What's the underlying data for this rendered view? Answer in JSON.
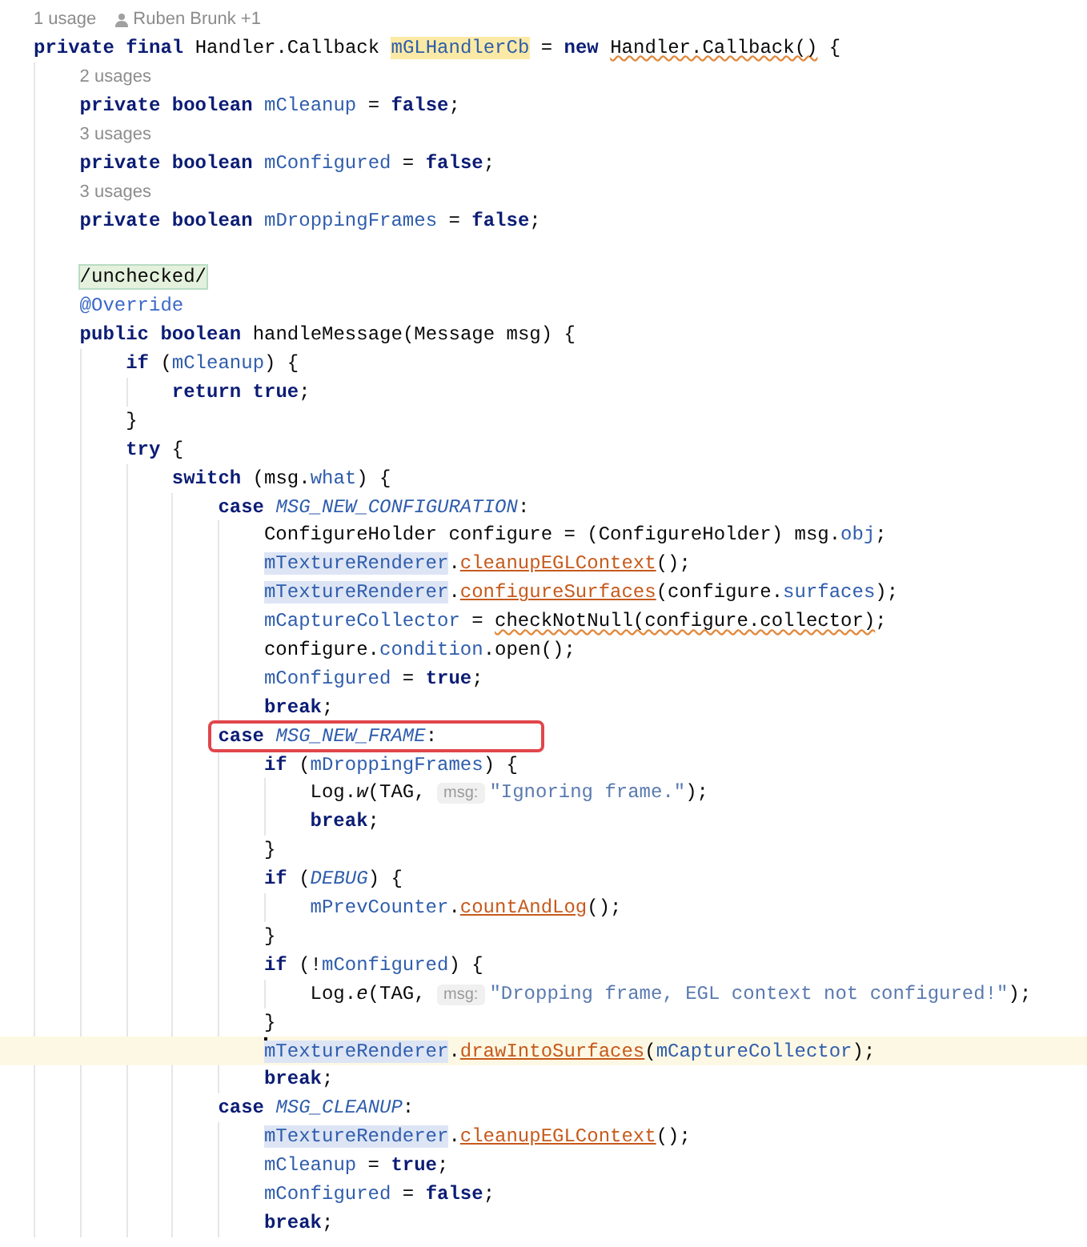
{
  "editor": {
    "lines": [
      {
        "kind": "usages",
        "text": "1 usage",
        "author": "Ruben Brunk +1"
      },
      {
        "kind": "code",
        "current": false,
        "tokens": [
          {
            "kind": "kw",
            "text": "private final"
          },
          {
            "kind": "plain",
            "text": " Handler.Callback "
          },
          {
            "kind": "field",
            "text": "mGLHandlerCb",
            "declaration_highlight": true
          },
          {
            "kind": "plain",
            "text": " = "
          },
          {
            "kind": "kw",
            "text": "new "
          },
          {
            "kind": "plain",
            "text": "Handler.Callback()",
            "warning": true
          },
          {
            "kind": "plain",
            "text": " {"
          }
        ],
        "children": [
          {
            "kind": "usages",
            "text": "2 usages"
          },
          {
            "kind": "code",
            "current": false,
            "tokens": [
              {
                "kind": "kw",
                "text": "private boolean "
              },
              {
                "kind": "field",
                "text": "mCleanup"
              },
              {
                "kind": "plain",
                "text": " = "
              },
              {
                "kind": "kw",
                "text": "false"
              },
              {
                "kind": "plain",
                "text": ";"
              }
            ]
          },
          {
            "kind": "usages",
            "text": "3 usages"
          },
          {
            "kind": "code",
            "current": false,
            "tokens": [
              {
                "kind": "kw",
                "text": "private boolean "
              },
              {
                "kind": "field",
                "text": "mConfigured"
              },
              {
                "kind": "plain",
                "text": " = "
              },
              {
                "kind": "kw",
                "text": "false"
              },
              {
                "kind": "plain",
                "text": ";"
              }
            ]
          },
          {
            "kind": "usages",
            "text": "3 usages"
          },
          {
            "kind": "code",
            "current": false,
            "tokens": [
              {
                "kind": "kw",
                "text": "private boolean "
              },
              {
                "kind": "field",
                "text": "mDroppingFrames"
              },
              {
                "kind": "plain",
                "text": " = "
              },
              {
                "kind": "kw",
                "text": "false"
              },
              {
                "kind": "plain",
                "text": ";"
              }
            ]
          },
          {
            "kind": "blank"
          },
          {
            "kind": "code",
            "current": false,
            "tokens": [
              {
                "kind": "plain",
                "text": "/unchecked/",
                "suppression_highlight": true
              }
            ]
          },
          {
            "kind": "code",
            "current": false,
            "tokens": [
              {
                "kind": "annotation",
                "text": "@Override"
              }
            ]
          },
          {
            "kind": "code",
            "current": false,
            "tokens": [
              {
                "kind": "kw",
                "text": "public boolean"
              },
              {
                "kind": "plain",
                "text": " handleMessage(Message msg) {"
              }
            ],
            "children": [
              {
                "kind": "code",
                "current": false,
                "tokens": [
                  {
                    "kind": "kw",
                    "text": "if"
                  },
                  {
                    "kind": "plain",
                    "text": " ("
                  },
                  {
                    "kind": "field",
                    "text": "mCleanup"
                  },
                  {
                    "kind": "plain",
                    "text": ") {"
                  }
                ],
                "children": [
                  {
                    "kind": "code",
                    "current": false,
                    "tokens": [
                      {
                        "kind": "kw",
                        "text": "return true"
                      },
                      {
                        "kind": "plain",
                        "text": ";"
                      }
                    ]
                  }
                ]
              },
              {
                "kind": "code",
                "current": false,
                "tokens": [
                  {
                    "kind": "plain",
                    "text": "}"
                  }
                ]
              },
              {
                "kind": "code",
                "current": false,
                "tokens": [
                  {
                    "kind": "kw",
                    "text": "try"
                  },
                  {
                    "kind": "plain",
                    "text": " {"
                  }
                ],
                "children": [
                  {
                    "kind": "code",
                    "current": false,
                    "tokens": [
                      {
                        "kind": "kw",
                        "text": "switch"
                      },
                      {
                        "kind": "plain",
                        "text": " (msg."
                      },
                      {
                        "kind": "field",
                        "text": "what"
                      },
                      {
                        "kind": "plain",
                        "text": ") {"
                      }
                    ],
                    "children": [
                      {
                        "kind": "code",
                        "current": false,
                        "tokens": [
                          {
                            "kind": "kw",
                            "text": "case "
                          },
                          {
                            "kind": "const",
                            "text": "MSG_NEW_CONFIGURATION"
                          },
                          {
                            "kind": "plain",
                            "text": ":"
                          }
                        ],
                        "children": [
                          {
                            "kind": "code",
                            "current": false,
                            "tokens": [
                              {
                                "kind": "plain",
                                "text": "ConfigureHolder configure = (ConfigureHolder) msg."
                              },
                              {
                                "kind": "field",
                                "text": "obj"
                              },
                              {
                                "kind": "plain",
                                "text": ";"
                              }
                            ]
                          },
                          {
                            "kind": "code",
                            "current": false,
                            "tokens": [
                              {
                                "kind": "field",
                                "text": "mTextureRenderer",
                                "usage_highlight": true
                              },
                              {
                                "kind": "plain",
                                "text": "."
                              },
                              {
                                "kind": "call",
                                "text": "cleanupEGLContext"
                              },
                              {
                                "kind": "plain",
                                "text": "();"
                              }
                            ]
                          },
                          {
                            "kind": "code",
                            "current": false,
                            "tokens": [
                              {
                                "kind": "field",
                                "text": "mTextureRenderer",
                                "usage_highlight": true
                              },
                              {
                                "kind": "plain",
                                "text": "."
                              },
                              {
                                "kind": "call",
                                "text": "configureSurfaces"
                              },
                              {
                                "kind": "plain",
                                "text": "(configure."
                              },
                              {
                                "kind": "field",
                                "text": "surfaces"
                              },
                              {
                                "kind": "plain",
                                "text": ");"
                              }
                            ]
                          },
                          {
                            "kind": "code",
                            "current": false,
                            "tokens": [
                              {
                                "kind": "field",
                                "text": "mCaptureCollector"
                              },
                              {
                                "kind": "plain",
                                "text": " = "
                              },
                              {
                                "kind": "call-plain",
                                "text": "checkNotNull(configure.collector)",
                                "warning": true
                              },
                              {
                                "kind": "plain",
                                "text": ";"
                              }
                            ]
                          },
                          {
                            "kind": "code",
                            "current": false,
                            "tokens": [
                              {
                                "kind": "plain",
                                "text": "configure."
                              },
                              {
                                "kind": "field",
                                "text": "condition"
                              },
                              {
                                "kind": "plain",
                                "text": ".open();"
                              }
                            ]
                          },
                          {
                            "kind": "code",
                            "current": false,
                            "tokens": [
                              {
                                "kind": "field",
                                "text": "mConfigured"
                              },
                              {
                                "kind": "plain",
                                "text": " = "
                              },
                              {
                                "kind": "kw",
                                "text": "true"
                              },
                              {
                                "kind": "plain",
                                "text": ";"
                              }
                            ]
                          },
                          {
                            "kind": "code",
                            "current": false,
                            "tokens": [
                              {
                                "kind": "kw",
                                "text": "break"
                              },
                              {
                                "kind": "plain",
                                "text": ";"
                              }
                            ]
                          }
                        ]
                      },
                      {
                        "kind": "code",
                        "current": false,
                        "tokens": [
                          {
                            "kind": "kw",
                            "text": "case "
                          },
                          {
                            "kind": "const",
                            "text": "MSG_NEW_FRAME",
                            "outlined": true
                          },
                          {
                            "kind": "plain",
                            "text": ":"
                          }
                        ],
                        "children": [
                          {
                            "kind": "code",
                            "current": false,
                            "tokens": [
                              {
                                "kind": "kw",
                                "text": "if"
                              },
                              {
                                "kind": "plain",
                                "text": " ("
                              },
                              {
                                "kind": "field",
                                "text": "mDroppingFrames"
                              },
                              {
                                "kind": "plain",
                                "text": ") {"
                              }
                            ],
                            "children": [
                              {
                                "kind": "code",
                                "current": false,
                                "tokens": [
                                  {
                                    "kind": "plain",
                                    "text": "Log."
                                  },
                                  {
                                    "kind": "static",
                                    "text": "w"
                                  },
                                  {
                                    "kind": "plain",
                                    "text": "(TAG, "
                                  },
                                  {
                                    "kind": "param-hint",
                                    "text": "msg:"
                                  },
                                  {
                                    "kind": "string",
                                    "text": "\"Ignoring frame.\""
                                  },
                                  {
                                    "kind": "plain",
                                    "text": ");"
                                  }
                                ]
                              },
                              {
                                "kind": "code",
                                "current": false,
                                "tokens": [
                                  {
                                    "kind": "kw",
                                    "text": "break"
                                  },
                                  {
                                    "kind": "plain",
                                    "text": ";"
                                  }
                                ]
                              }
                            ]
                          },
                          {
                            "kind": "code",
                            "current": false,
                            "tokens": [
                              {
                                "kind": "plain",
                                "text": "}"
                              }
                            ]
                          },
                          {
                            "kind": "code",
                            "current": false,
                            "tokens": [
                              {
                                "kind": "kw",
                                "text": "if"
                              },
                              {
                                "kind": "plain",
                                "text": " ("
                              },
                              {
                                "kind": "const",
                                "text": "DEBUG"
                              },
                              {
                                "kind": "plain",
                                "text": ") {"
                              }
                            ],
                            "children": [
                              {
                                "kind": "code",
                                "current": false,
                                "tokens": [
                                  {
                                    "kind": "field",
                                    "text": "mPrevCounter"
                                  },
                                  {
                                    "kind": "plain",
                                    "text": "."
                                  },
                                  {
                                    "kind": "call",
                                    "text": "countAndLog"
                                  },
                                  {
                                    "kind": "plain",
                                    "text": "();"
                                  }
                                ]
                              }
                            ]
                          },
                          {
                            "kind": "code",
                            "current": false,
                            "tokens": [
                              {
                                "kind": "plain",
                                "text": "}"
                              }
                            ]
                          },
                          {
                            "kind": "code",
                            "current": false,
                            "tokens": [
                              {
                                "kind": "kw",
                                "text": "if"
                              },
                              {
                                "kind": "plain",
                                "text": " (!"
                              },
                              {
                                "kind": "field",
                                "text": "mConfigured"
                              },
                              {
                                "kind": "plain",
                                "text": ") {"
                              }
                            ],
                            "children": [
                              {
                                "kind": "code",
                                "current": false,
                                "tokens": [
                                  {
                                    "kind": "plain",
                                    "text": "Log."
                                  },
                                  {
                                    "kind": "static",
                                    "text": "e"
                                  },
                                  {
                                    "kind": "plain",
                                    "text": "(TAG, "
                                  },
                                  {
                                    "kind": "param-hint",
                                    "text": "msg:"
                                  },
                                  {
                                    "kind": "string",
                                    "text": "\"Dropping frame, EGL context not configured!\""
                                  },
                                  {
                                    "kind": "plain",
                                    "text": ");"
                                  }
                                ]
                              }
                            ]
                          },
                          {
                            "kind": "code",
                            "current": false,
                            "tokens": [
                              {
                                "kind": "plain",
                                "text": "}"
                              }
                            ]
                          },
                          {
                            "kind": "code",
                            "current": true,
                            "tokens": [
                              {
                                "kind": "field",
                                "text": "mTextureRenderer",
                                "usage_highlight": true
                              },
                              {
                                "kind": "plain",
                                "text": "."
                              },
                              {
                                "kind": "call",
                                "text": "drawIntoSurfaces"
                              },
                              {
                                "kind": "plain",
                                "text": "("
                              },
                              {
                                "kind": "field",
                                "text": "mCaptureCollector"
                              },
                              {
                                "kind": "plain",
                                "text": ");"
                              }
                            ]
                          },
                          {
                            "kind": "code",
                            "current": false,
                            "tokens": [
                              {
                                "kind": "kw",
                                "text": "break"
                              },
                              {
                                "kind": "plain",
                                "text": ";"
                              }
                            ]
                          }
                        ]
                      },
                      {
                        "kind": "code",
                        "current": false,
                        "tokens": [
                          {
                            "kind": "kw",
                            "text": "case "
                          },
                          {
                            "kind": "const",
                            "text": "MSG_CLEANUP"
                          },
                          {
                            "kind": "plain",
                            "text": ":"
                          }
                        ],
                        "children": [
                          {
                            "kind": "code",
                            "current": false,
                            "tokens": [
                              {
                                "kind": "field",
                                "text": "mTextureRenderer",
                                "usage_highlight": true
                              },
                              {
                                "kind": "plain",
                                "text": "."
                              },
                              {
                                "kind": "call",
                                "text": "cleanupEGLContext"
                              },
                              {
                                "kind": "plain",
                                "text": "();"
                              }
                            ]
                          },
                          {
                            "kind": "code",
                            "current": false,
                            "tokens": [
                              {
                                "kind": "field",
                                "text": "mCleanup"
                              },
                              {
                                "kind": "plain",
                                "text": " = "
                              },
                              {
                                "kind": "kw",
                                "text": "true"
                              },
                              {
                                "kind": "plain",
                                "text": ";"
                              }
                            ]
                          },
                          {
                            "kind": "code",
                            "current": false,
                            "tokens": [
                              {
                                "kind": "field",
                                "text": "mConfigured"
                              },
                              {
                                "kind": "plain",
                                "text": " = "
                              },
                              {
                                "kind": "kw",
                                "text": "false"
                              },
                              {
                                "kind": "plain",
                                "text": ";"
                              }
                            ]
                          },
                          {
                            "kind": "code",
                            "current": false,
                            "tokens": [
                              {
                                "kind": "kw",
                                "text": "break"
                              },
                              {
                                "kind": "plain",
                                "text": ";"
                              }
                            ]
                          }
                        ]
                      }
                    ]
                  }
                ]
              }
            ]
          }
        ]
      }
    ]
  }
}
